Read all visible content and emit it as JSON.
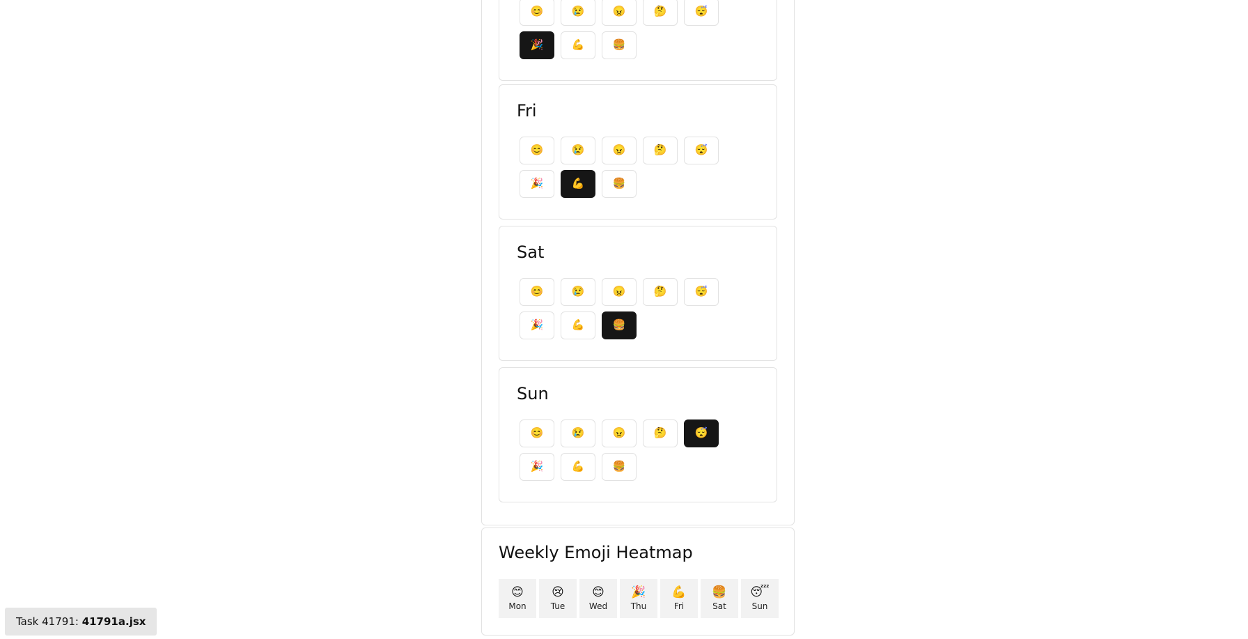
{
  "emojis": [
    "😊",
    "😢",
    "😠",
    "🤔",
    "😴",
    "🎉",
    "💪",
    "🍔"
  ],
  "emoji_names": [
    "smile",
    "sad",
    "angry",
    "thinking",
    "sleepy",
    "party",
    "muscle",
    "burger"
  ],
  "days": [
    {
      "name": "Thu",
      "selected": 5,
      "title_visible": false
    },
    {
      "name": "Fri",
      "selected": 6,
      "title_visible": true
    },
    {
      "name": "Sat",
      "selected": 7,
      "title_visible": true
    },
    {
      "name": "Sun",
      "selected": 4,
      "title_visible": true
    }
  ],
  "heatmap": {
    "title": "Weekly Emoji Heatmap",
    "cells": [
      {
        "emoji": "😊",
        "day": "Mon"
      },
      {
        "emoji": "😢",
        "day": "Tue"
      },
      {
        "emoji": "😊",
        "day": "Wed"
      },
      {
        "emoji": "🎉",
        "day": "Thu"
      },
      {
        "emoji": "💪",
        "day": "Fri"
      },
      {
        "emoji": "🍔",
        "day": "Sat"
      },
      {
        "emoji": "😴",
        "day": "Sun"
      }
    ]
  },
  "task_badge": {
    "prefix": "Task 41791: ",
    "filename": "41791a.jsx"
  }
}
